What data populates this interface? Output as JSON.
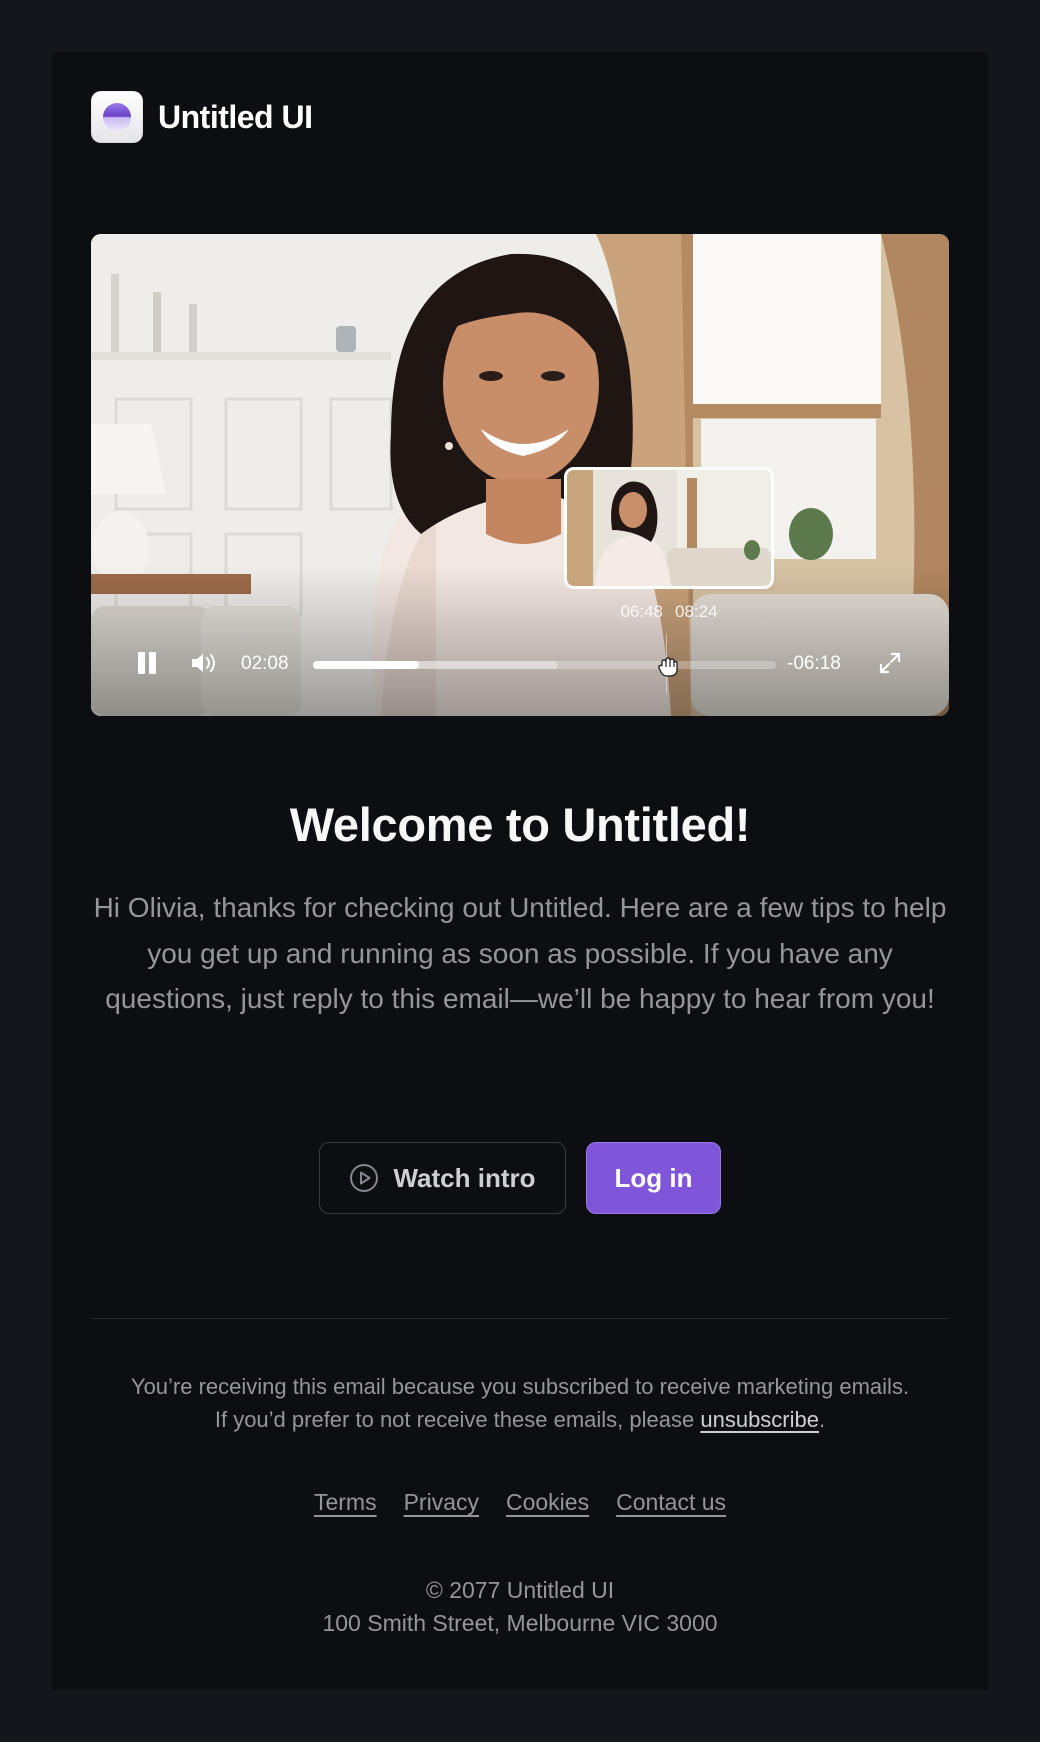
{
  "brand": {
    "name": "Untitled UI"
  },
  "video": {
    "elapsed": "02:08",
    "remaining": "-06:18",
    "preview_time": "06:48",
    "preview_total": "08:24",
    "progress_played": 0.23,
    "progress_buffered": 0.53
  },
  "content": {
    "headline": "Welcome to Untitled!",
    "intro": "Hi Olivia, thanks for checking out Untitled. Here are a few tips to help you get up and running as soon as possible. If you have any questions, just reply to this email—we’ll be happy to hear from you!"
  },
  "actions": {
    "watch_intro": "Watch intro",
    "login": "Log in"
  },
  "footer": {
    "notice_line1": "You’re receiving this email because you subscribed to receive marketing emails.",
    "notice_line2": "If you’d prefer to not receive these emails, please",
    "unsubscribe": "unsubscribe",
    "notice_end": ".",
    "links": [
      "Terms",
      "Privacy",
      "Cookies",
      "Contact us"
    ],
    "copyright": "© 2077 Untitled UI",
    "address": "100 Smith Street, Melbourne VIC 3000"
  },
  "colors": {
    "page_bg": "#13161b",
    "card_bg": "#0c0e12",
    "primary": "#7f56d9",
    "muted_text": "#94969c"
  }
}
